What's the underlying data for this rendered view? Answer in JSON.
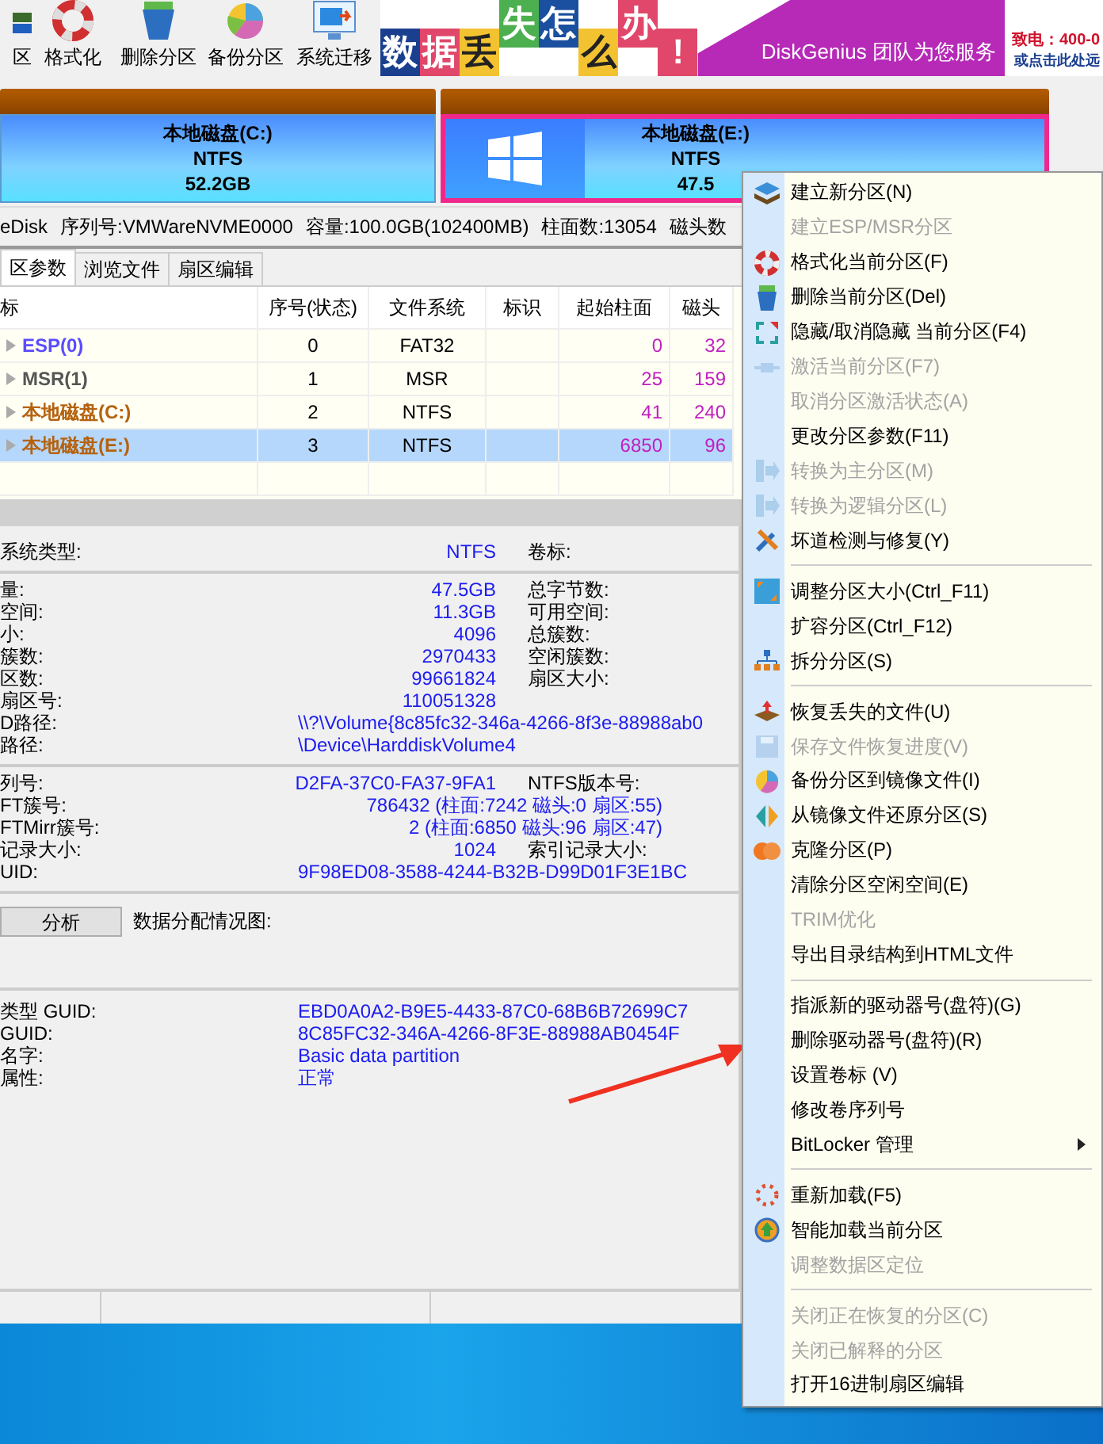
{
  "toolbar": {
    "buttons": [
      {
        "label": "区"
      },
      {
        "label": "格式化"
      },
      {
        "label": "删除分区"
      },
      {
        "label": "备份分区"
      },
      {
        "label": "系统迁移"
      }
    ]
  },
  "banner": {
    "characters": [
      {
        "text": "数",
        "color": "#1b3f8f",
        "raised": false
      },
      {
        "text": "据",
        "color": "#e0476a",
        "raised": false
      },
      {
        "text": "丢",
        "color": "#f2c230",
        "raised": false
      },
      {
        "text": "失",
        "color": "#4caf50",
        "raised": true
      },
      {
        "text": "怎",
        "color": "#1b4f9f",
        "raised": true
      },
      {
        "text": "么",
        "color": "#f2c230",
        "raised": false
      },
      {
        "text": "办",
        "color": "#e0476a",
        "raised": true
      },
      {
        "text": "!",
        "color": "#e0476a",
        "raised": false
      }
    ],
    "slogan": "DiskGenius 团队为您服务",
    "phone": "致电：400-0",
    "link": "或点击此处远"
  },
  "disk_map": {
    "partitions": [
      {
        "label": "本地磁盘(C:)",
        "fs": "NTFS",
        "size": "52.2GB",
        "selected": false
      },
      {
        "label": "本地磁盘(E:)",
        "fs": "NTFS",
        "size": "47.5",
        "selected": true
      }
    ]
  },
  "disk_info": [
    "eDisk",
    "序列号:VMWareNVME0000",
    "容量:100.0GB(102400MB)",
    "柱面数:13054",
    "磁头数"
  ],
  "tabs": [
    {
      "label": "区参数",
      "selected": true
    },
    {
      "label": "浏览文件",
      "selected": false
    },
    {
      "label": "扇区编辑",
      "selected": false
    }
  ],
  "table": {
    "columns": [
      "标",
      "序号(状态)",
      "文件系统",
      "标识",
      "起始柱面",
      "磁头"
    ],
    "rows": [
      {
        "cells": [
          "ESP(0)",
          "0",
          "FAT32",
          "",
          "0",
          "32"
        ],
        "color": "#5b4cff",
        "selected": false
      },
      {
        "cells": [
          "MSR(1)",
          "1",
          "MSR",
          "",
          "25",
          "159"
        ],
        "color": "#555555",
        "selected": false
      },
      {
        "cells": [
          "本地磁盘(C:)",
          "2",
          "NTFS",
          "",
          "41",
          "240"
        ],
        "color": "#b5620e",
        "selected": false
      },
      {
        "cells": [
          "本地磁盘(E:)",
          "3",
          "NTFS",
          "",
          "6850",
          "96"
        ],
        "color": "#b5620e",
        "selected": true
      }
    ]
  },
  "details": {
    "sections": [
      [
        {
          "kind": "pair",
          "label": "系统类型:",
          "value": "NTFS",
          "label2": "卷标:"
        }
      ],
      [
        {
          "kind": "pair",
          "label": "量:",
          "value": "47.5GB",
          "label2": "总字节数:"
        },
        {
          "kind": "pair",
          "label": "空间:",
          "value": "11.3GB",
          "label2": "可用空间:"
        },
        {
          "kind": "pair",
          "label": "小:",
          "value": "4096",
          "label2": "总簇数:"
        },
        {
          "kind": "pair",
          "label": "簇数:",
          "value": "2970433",
          "label2": "空闲簇数:"
        },
        {
          "kind": "pair",
          "label": "区数:",
          "value": "99661824",
          "label2": "扇区大小:"
        },
        {
          "kind": "pair",
          "label": "扇区号:",
          "value": "110051328"
        },
        {
          "kind": "wide",
          "label": "D路径:",
          "value": "\\\\?\\Volume{8c85fc32-346a-4266-8f3e-88988ab0"
        },
        {
          "kind": "wide",
          "label": "路径:",
          "value": "\\Device\\HarddiskVolume4"
        }
      ],
      [
        {
          "kind": "pair",
          "label": "列号:",
          "value": "D2FA-37C0-FA37-9FA1",
          "label2": "NTFS版本号:"
        },
        {
          "kind": "long",
          "label": "FT簇号:",
          "value": "786432 (柱面:7242 磁头:0 扇区:55)"
        },
        {
          "kind": "long",
          "label": "FTMirr簇号:",
          "value": "2 (柱面:6850 磁头:96 扇区:47)"
        },
        {
          "kind": "pair",
          "label": "记录大小:",
          "value": "1024",
          "label2": "索引记录大小:"
        },
        {
          "kind": "wide",
          "label": "UID:",
          "value": "9F98ED08-3588-4244-B32B-D99D01F3E1BC"
        }
      ]
    ],
    "analysis": {
      "button": "分析",
      "label": "数据分配情况图:"
    },
    "guid_rows": [
      {
        "kind": "wide",
        "label": "类型 GUID:",
        "value": "EBD0A0A2-B9E5-4433-87C0-68B6B72699C7"
      },
      {
        "kind": "wide",
        "label": "GUID:",
        "value": "8C85FC32-346A-4266-8F3E-88988AB0454F"
      },
      {
        "kind": "wide",
        "label": "名字:",
        "value": "Basic data partition"
      },
      {
        "kind": "wide",
        "label": "属性:",
        "value": "正常"
      }
    ]
  },
  "context_menu": {
    "items": [
      {
        "kind": "item",
        "label": "建立新分区(N)",
        "disabled": false
      },
      {
        "kind": "item",
        "label": "建立ESP/MSR分区",
        "disabled": true
      },
      {
        "kind": "item",
        "label": "格式化当前分区(F)",
        "disabled": false
      },
      {
        "kind": "item",
        "label": "删除当前分区(Del)",
        "disabled": false
      },
      {
        "kind": "item",
        "label": "隐藏/取消隐藏 当前分区(F4)",
        "disabled": false
      },
      {
        "kind": "item",
        "label": "激活当前分区(F7)",
        "disabled": true
      },
      {
        "kind": "item",
        "label": "取消分区激活状态(A)",
        "disabled": true
      },
      {
        "kind": "item",
        "label": "更改分区参数(F11)",
        "disabled": false
      },
      {
        "kind": "item",
        "label": "转换为主分区(M)",
        "disabled": true
      },
      {
        "kind": "item",
        "label": "转换为逻辑分区(L)",
        "disabled": true
      },
      {
        "kind": "item",
        "label": "坏道检测与修复(Y)",
        "disabled": false
      },
      {
        "kind": "separator"
      },
      {
        "kind": "item",
        "label": "调整分区大小(Ctrl_F11)",
        "disabled": false
      },
      {
        "kind": "item",
        "label": "扩容分区(Ctrl_F12)",
        "disabled": false
      },
      {
        "kind": "item",
        "label": "拆分分区(S)",
        "disabled": false
      },
      {
        "kind": "separator"
      },
      {
        "kind": "item",
        "label": "恢复丢失的文件(U)",
        "disabled": false
      },
      {
        "kind": "item",
        "label": "保存文件恢复进度(V)",
        "disabled": true
      },
      {
        "kind": "item",
        "label": "备份分区到镜像文件(I)",
        "disabled": false
      },
      {
        "kind": "item",
        "label": "从镜像文件还原分区(S)",
        "disabled": false
      },
      {
        "kind": "item",
        "label": "克隆分区(P)",
        "disabled": false
      },
      {
        "kind": "item",
        "label": "清除分区空闲空间(E)",
        "disabled": false
      },
      {
        "kind": "item",
        "label": "TRIM优化",
        "disabled": true
      },
      {
        "kind": "item",
        "label": "导出目录结构到HTML文件",
        "disabled": false
      },
      {
        "kind": "separator"
      },
      {
        "kind": "item",
        "label": "指派新的驱动器号(盘符)(G)",
        "disabled": false
      },
      {
        "kind": "item",
        "label": "删除驱动器号(盘符)(R)",
        "disabled": false
      },
      {
        "kind": "item",
        "label": "设置卷标 (V)",
        "disabled": false
      },
      {
        "kind": "item",
        "label": "修改卷序列号",
        "disabled": false
      },
      {
        "kind": "item",
        "label": "BitLocker 管理",
        "disabled": false,
        "submenu": true
      },
      {
        "kind": "separator"
      },
      {
        "kind": "item",
        "label": "重新加载(F5)",
        "disabled": false
      },
      {
        "kind": "item",
        "label": "智能加载当前分区",
        "disabled": false
      },
      {
        "kind": "item",
        "label": "调整数据区定位",
        "disabled": true
      },
      {
        "kind": "separator"
      },
      {
        "kind": "item",
        "label": "关闭正在恢复的分区(C)",
        "disabled": true
      },
      {
        "kind": "item",
        "label": "关闭已解释的分区",
        "disabled": true
      },
      {
        "kind": "item",
        "label": "打开16进制扇区编辑",
        "disabled": false
      }
    ]
  }
}
